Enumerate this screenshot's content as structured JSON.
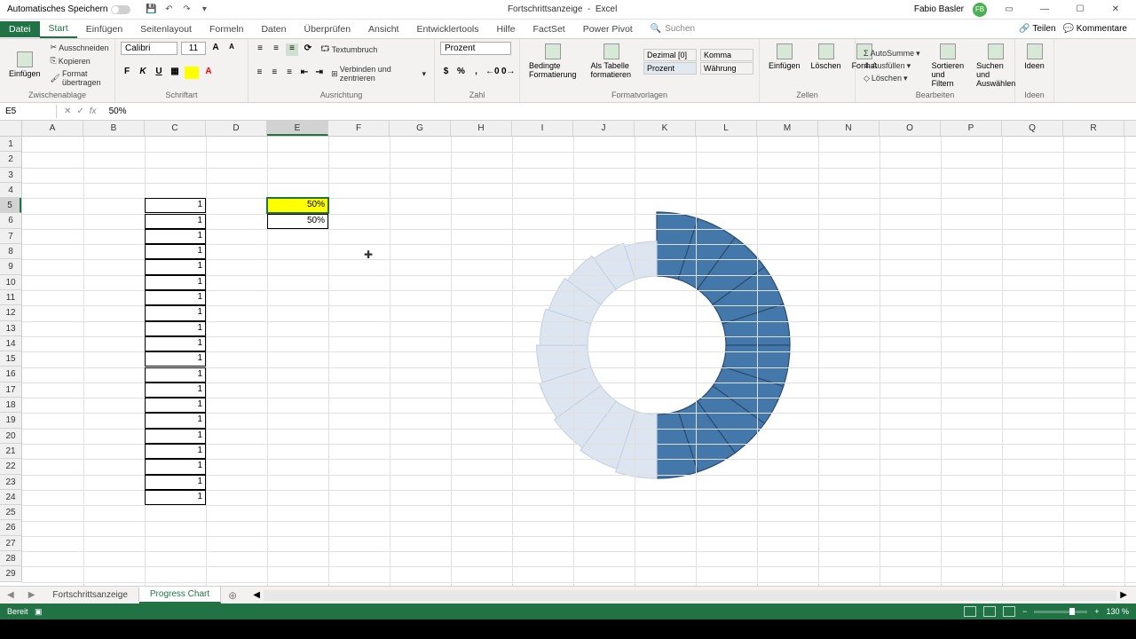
{
  "title": {
    "doc": "Fortschrittsanzeige",
    "app": "Excel",
    "autosave": "Automatisches Speichern",
    "user": "Fabio Basler",
    "avatar": "FB"
  },
  "tabs": {
    "file": "Datei",
    "home": "Start",
    "insert": "Einfügen",
    "layout": "Seitenlayout",
    "formulas": "Formeln",
    "data": "Daten",
    "review": "Überprüfen",
    "view": "Ansicht",
    "dev": "Entwicklertools",
    "help": "Hilfe",
    "factset": "FactSet",
    "powerpivot": "Power Pivot",
    "search": "Suchen",
    "share": "Teilen",
    "comments": "Kommentare"
  },
  "ribbon": {
    "clipboard": {
      "label": "Zwischenablage",
      "cut": "Ausschneiden",
      "copy": "Kopieren",
      "paint": "Format übertragen",
      "paste": "Einfügen"
    },
    "font": {
      "label": "Schriftart",
      "name": "Calibri",
      "size": "11"
    },
    "align": {
      "label": "Ausrichtung",
      "wrap": "Textumbruch",
      "merge": "Verbinden und zentrieren"
    },
    "number": {
      "label": "Zahl",
      "format": "Prozent"
    },
    "styles": {
      "label": "Formatvorlagen",
      "cond": "Bedingte Formatierung",
      "table": "Als Tabelle formatieren",
      "dec0": "Dezimal [0]",
      "comma": "Komma",
      "percent": "Prozent",
      "currency": "Währung"
    },
    "cells": {
      "label": "Zellen",
      "ins": "Einfügen",
      "del": "Löschen",
      "fmt": "Format"
    },
    "editing": {
      "label": "Bearbeiten",
      "sum": "AutoSumme",
      "fill": "Ausfüllen",
      "clear": "Löschen",
      "sort": "Sortieren und Filtern",
      "find": "Suchen und Auswählen"
    },
    "ideas": {
      "label": "Ideen",
      "btn": "Ideen"
    }
  },
  "formula": {
    "ref": "E5",
    "value": "50%"
  },
  "cols": [
    "A",
    "B",
    "C",
    "D",
    "E",
    "F",
    "G",
    "H",
    "I",
    "J",
    "K",
    "L",
    "M",
    "N",
    "O",
    "P",
    "Q",
    "R"
  ],
  "data_c": [
    "1",
    "1",
    "1",
    "1",
    "1",
    "1",
    "1",
    "1",
    "1",
    "1",
    "1",
    "1",
    "1",
    "1",
    "1",
    "1",
    "1",
    "1",
    "1",
    "1"
  ],
  "e5": "50%",
  "e6": "50%",
  "sheets": {
    "s1": "Fortschrittsanzeige",
    "s2": "Progress Chart"
  },
  "status": {
    "ready": "Bereit",
    "zoom": "130 %"
  },
  "chart_data": {
    "type": "pie",
    "segments": 20,
    "progress_pct": 50,
    "filled_segments": 10,
    "empty_segments": 10,
    "donut": true
  }
}
